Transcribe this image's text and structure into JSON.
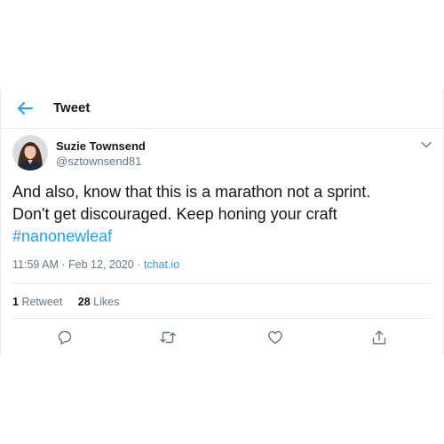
{
  "header": {
    "title": "Tweet"
  },
  "author": {
    "name": "Suzie Townsend",
    "handle": "@sztownsend81"
  },
  "tweet": {
    "line1": "And also, know that this is a marathon not a sprint.",
    "line2": "Don't get discouraged. Keep honing your craft",
    "hashtag": "#nanonewleaf",
    "time": "11:59 AM",
    "separator1": "·",
    "date": "Feb 12, 2020",
    "separator2": "·",
    "source": "tchat.io"
  },
  "stats": {
    "retweets_count": "1",
    "retweets_label": "Retweet",
    "likes_count": "28",
    "likes_label": "Likes"
  },
  "colors": {
    "accent": "#1da1f2",
    "text": "#14171a",
    "muted": "#657786",
    "border": "#e6ecf0"
  },
  "icons": [
    "back-arrow-icon",
    "chevron-down-icon",
    "reply-icon",
    "retweet-icon",
    "like-icon",
    "share-icon"
  ]
}
